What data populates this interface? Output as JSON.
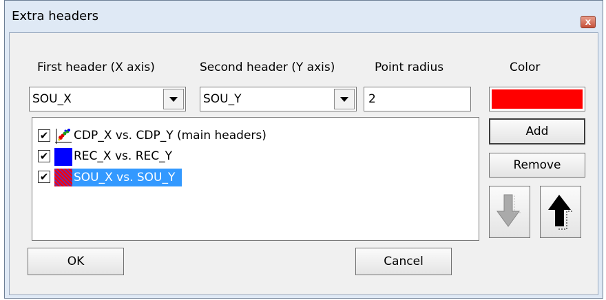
{
  "window": {
    "title": "Extra headers",
    "close_glyph": "x"
  },
  "labels": {
    "first_header": "First header (X axis)",
    "second_header": "Second header (Y axis)",
    "point_radius": "Point radius",
    "color": "Color"
  },
  "fields": {
    "first_header_value": "SOU_X",
    "second_header_value": "SOU_Y",
    "point_radius_value": "2",
    "color_value": "#ff0000"
  },
  "list": [
    {
      "checked": true,
      "icon": "scatter-plot-icon",
      "label": "CDP_X vs. CDP_Y  (main headers)"
    },
    {
      "checked": true,
      "icon": "blue-swatch-icon",
      "color": "#0000ff",
      "label": "REC_X vs. REC_Y"
    },
    {
      "checked": true,
      "icon": "red-swatch-icon",
      "color": "#ff0000",
      "label": "SOU_X vs. SOU_Y",
      "selected": true
    }
  ],
  "buttons": {
    "add": "Add",
    "remove": "Remove",
    "ok": "OK",
    "cancel": "Cancel",
    "move_down_icon": "arrow-down-icon",
    "move_up_icon": "arrow-up-icon"
  },
  "check_glyph": "✔"
}
